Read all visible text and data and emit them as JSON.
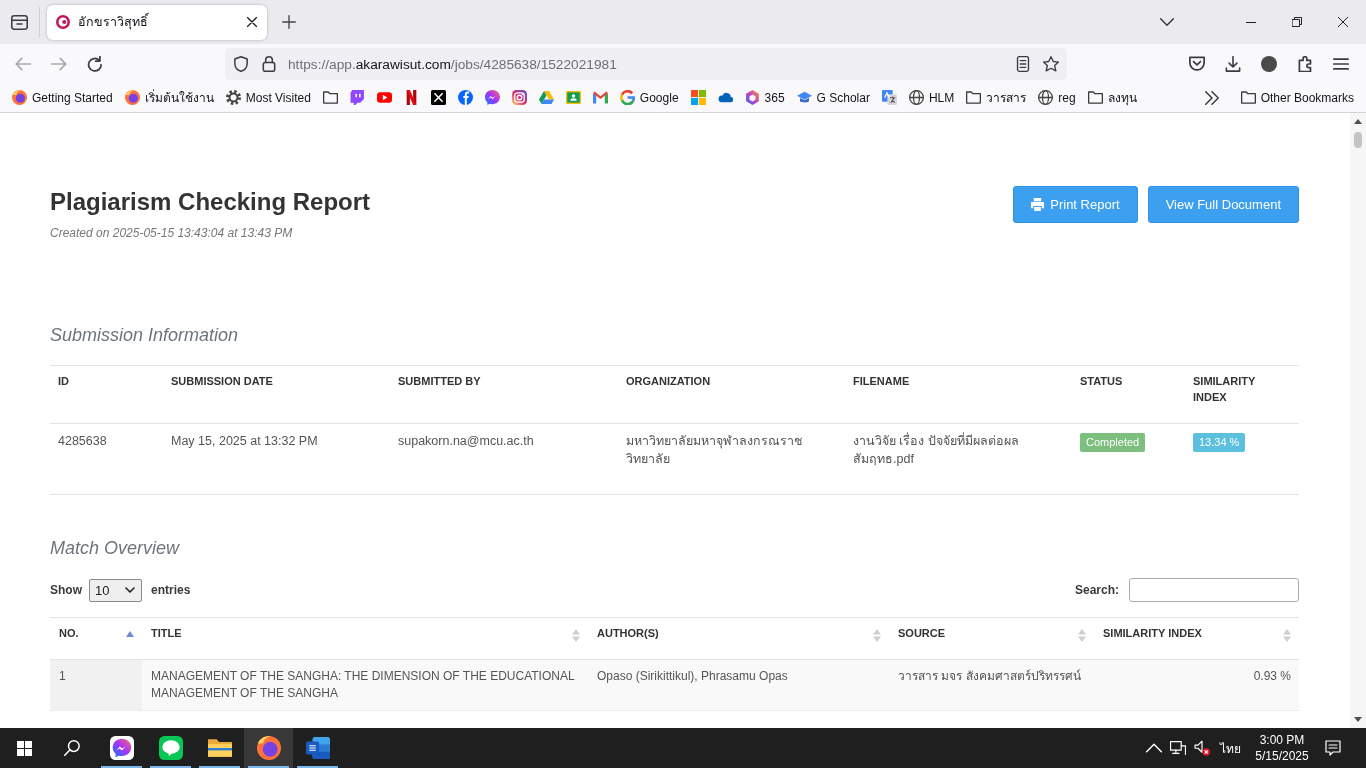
{
  "browser": {
    "tabs": [
      {
        "title": "อักขราวิสุทธิ์",
        "selected": true
      }
    ],
    "address": [
      {
        "text": "https://app.",
        "emphasis": false
      },
      {
        "text": "akarawisut.com",
        "emphasis": true
      },
      {
        "text": "/jobs/4285638/1522021981",
        "emphasis": false
      }
    ],
    "bookmarks": [
      {
        "kind": "fox",
        "label": "Getting Started"
      },
      {
        "kind": "fox",
        "label": "เริ่มต้นใช้งาน"
      },
      {
        "kind": "gear",
        "label": "Most Visited"
      },
      {
        "kind": "folder"
      },
      {
        "kind": "bubble"
      },
      {
        "kind": "play"
      },
      {
        "kind": "n"
      },
      {
        "kind": "x"
      },
      {
        "kind": "f"
      },
      {
        "kind": "bolt"
      },
      {
        "kind": "camera"
      },
      {
        "kind": "triangle"
      },
      {
        "kind": "board"
      },
      {
        "kind": "m"
      },
      {
        "kind": "g",
        "label": "Google"
      },
      {
        "kind": "squares"
      },
      {
        "kind": "cloud"
      },
      {
        "kind": "hexagon",
        "label": "365"
      },
      {
        "kind": "cap",
        "label": "G Scholar"
      },
      {
        "kind": "translate"
      },
      {
        "kind": "globe",
        "label": "HLM"
      },
      {
        "kind": "folder",
        "label": "วารสาร"
      },
      {
        "kind": "globe",
        "label": "reg"
      },
      {
        "kind": "folder",
        "label": "ลงทุน"
      }
    ],
    "other_bookmarks": "Other Bookmarks"
  },
  "report": {
    "title": "Plagiarism Checking Report",
    "created": "Created on 2025-05-15 13:43:04 at 13:43 PM",
    "buttons": [
      {
        "label": "Print Report",
        "kind": "print"
      },
      {
        "label": "View Full Document",
        "kind": "plain"
      }
    ]
  },
  "submission": {
    "heading": "Submission Information",
    "columns": [
      {
        "label": "ID",
        "kind": "text"
      },
      {
        "label": "SUBMISSION DATE",
        "kind": "text"
      },
      {
        "label": "SUBMITTED BY",
        "kind": "text"
      },
      {
        "label": "ORGANIZATION",
        "kind": "text"
      },
      {
        "label": "FILENAME",
        "kind": "text"
      },
      {
        "label": "STATUS",
        "kind": "status"
      },
      {
        "label": "SIMILARITY INDEX",
        "kind": "score"
      }
    ],
    "rows": [
      {
        "cells": [
          "4285638",
          "May 15, 2025 at 13:32 PM",
          "supakorn.na@mcu.ac.th",
          "มหาวิทยาลัยมหาจุฬาลงกรณราชวิทยาลัย",
          "งานวิจัย เรื่อง ปัจจัยที่มีผลต่อผลสัมฤทธ.pdf",
          "Completed",
          "13.34 %"
        ]
      }
    ]
  },
  "match_overview": {
    "heading": "Match Overview",
    "length_menu": {
      "before": "Show",
      "value": "10",
      "after": "entries"
    },
    "search": {
      "label": "Search:"
    },
    "columns": [
      {
        "label": "NO.",
        "kind": "text",
        "sorted": true
      },
      {
        "label": "TITLE",
        "kind": "text",
        "sorted": false
      },
      {
        "label": "AUTHOR(S)",
        "kind": "text",
        "sorted": false
      },
      {
        "label": "SOURCE",
        "kind": "text",
        "sorted": false
      },
      {
        "label": "SIMILARITY INDEX",
        "kind": "number",
        "sorted": false
      }
    ],
    "rows": [
      {
        "cells": [
          "1",
          "MANAGEMENT OF THE SANGHA: THE DIMENSION OF THE EDUCATIONAL MANAGEMENT OF THE SANGHA",
          "Opaso (Sirikittikul), Phrasamu Opas",
          "วารสาร มจร สังคมศาสตร์ปริทรรศน์",
          "0.93 %"
        ]
      }
    ]
  },
  "taskbar": {
    "apps": [
      {
        "kind": "bolt",
        "running": true,
        "selected": false
      },
      {
        "kind": "chat",
        "running": true,
        "selected": false
      },
      {
        "kind": "folder",
        "running": true,
        "selected": false
      },
      {
        "kind": "fox",
        "running": true,
        "selected": true
      },
      {
        "kind": "document",
        "running": true,
        "selected": false
      }
    ],
    "language": "ไทย",
    "time": "3:00 PM",
    "date": "5/15/2025"
  }
}
